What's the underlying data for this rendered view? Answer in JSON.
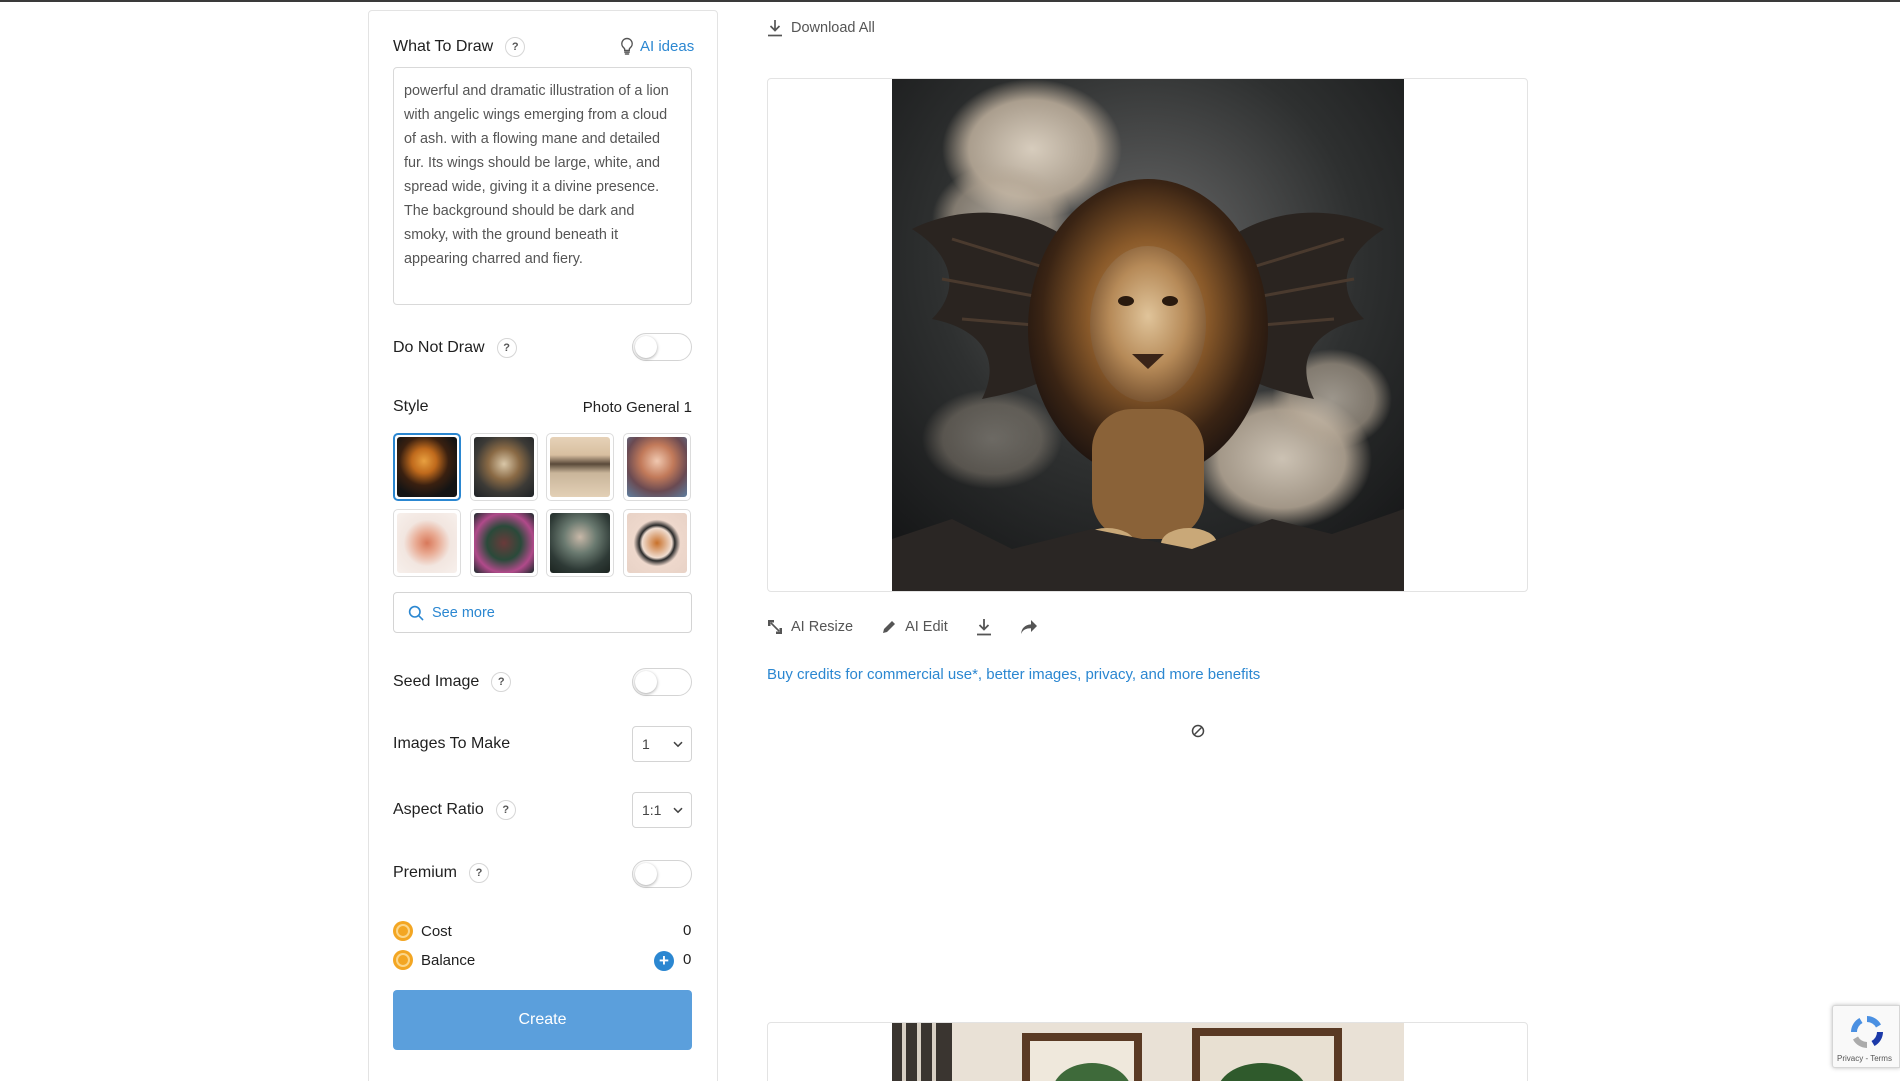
{
  "panel": {
    "what_to_draw_label": "What To Draw",
    "ai_ideas_label": "AI ideas",
    "prompt_text": "powerful and dramatic illustration of a lion with angelic wings emerging from a cloud of ash. with a flowing mane and detailed fur. Its wings should be large, white, and spread wide, giving it a divine presence. The background should be dark and smoky, with the ground beneath it appearing charred and fiery.",
    "do_not_draw_label": "Do Not Draw",
    "do_not_draw_on": false,
    "style_label": "Style",
    "style_value": "Photo General 1",
    "style_thumbs": [
      {
        "name": "tiger",
        "selected": true
      },
      {
        "name": "armored-cow",
        "selected": false
      },
      {
        "name": "violinist",
        "selected": false
      },
      {
        "name": "woman-portrait",
        "selected": false
      },
      {
        "name": "dancer-figure",
        "selected": false
      },
      {
        "name": "floral-woman",
        "selected": false
      },
      {
        "name": "old-man",
        "selected": false
      },
      {
        "name": "dog-emblem",
        "selected": false
      }
    ],
    "see_more_label": "See more",
    "seed_image_label": "Seed Image",
    "seed_image_on": false,
    "images_to_make_label": "Images To Make",
    "images_to_make_value": "1",
    "aspect_ratio_label": "Aspect Ratio",
    "aspect_ratio_value": "1:1",
    "premium_label": "Premium",
    "premium_on": false,
    "cost_label": "Cost",
    "cost_value": "0",
    "balance_label": "Balance",
    "balance_value": "0",
    "create_label": "Create",
    "help_glyph": "?"
  },
  "results": {
    "download_all_label": "Download All",
    "actions": {
      "ai_resize_label": "AI Resize",
      "ai_edit_label": "AI Edit"
    },
    "buy_credits_link": "Buy credits for commercial use*, better images, privacy, and more benefits"
  },
  "recaptcha": {
    "footer_text": "Privacy - Terms"
  },
  "colors": {
    "accent": "#2b87d1",
    "create_button": "#5b9fdc",
    "coin": "#f3a623"
  }
}
